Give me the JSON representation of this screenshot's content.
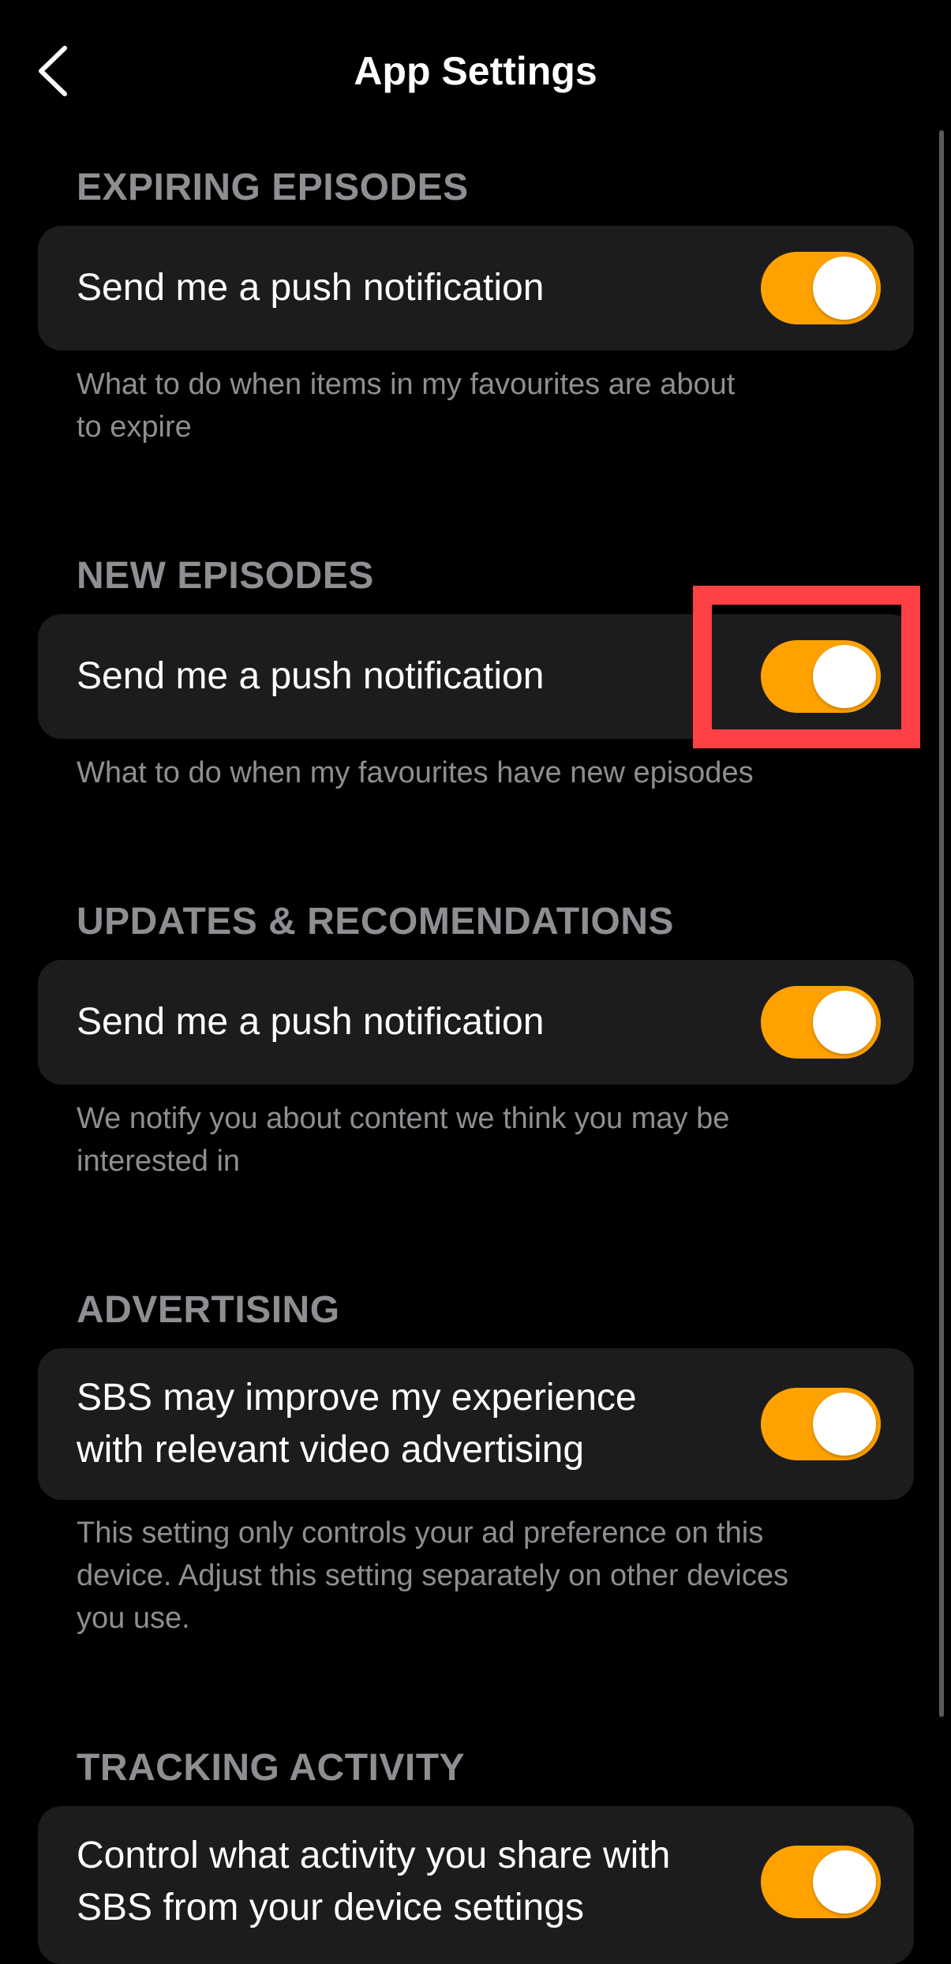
{
  "header": {
    "title": "App Settings",
    "back_icon": "chevron-left-icon"
  },
  "sections": [
    {
      "title": "EXPIRING EPISODES",
      "label": "Send me a push notification",
      "toggle_on": true,
      "description": "What to do when items in my favourites are about\nto expire"
    },
    {
      "title": "NEW EPISODES",
      "label": "Send me a push notification",
      "toggle_on": true,
      "description": "What to do when my favourites have new episodes"
    },
    {
      "title": "UPDATES & RECOMENDATIONS",
      "label": "Send me a push notification",
      "toggle_on": true,
      "description": "We notify you about content we think you may be\ninterested in"
    },
    {
      "title": "ADVERTISING",
      "label": "SBS may improve my experience\nwith relevant video advertising",
      "toggle_on": true,
      "description": "This setting only controls your ad preference on this\ndevice. Adjust this setting separately on other devices\nyou use."
    },
    {
      "title": "TRACKING ACTIVITY",
      "label": "Control what activity you share with\nSBS from your device settings",
      "toggle_on": true
    }
  ],
  "colors": {
    "background": "#000000",
    "card": "#1c1c1e",
    "accent": "#ffa200",
    "section_title": "#8e8e93",
    "highlight": "#ff4044"
  }
}
